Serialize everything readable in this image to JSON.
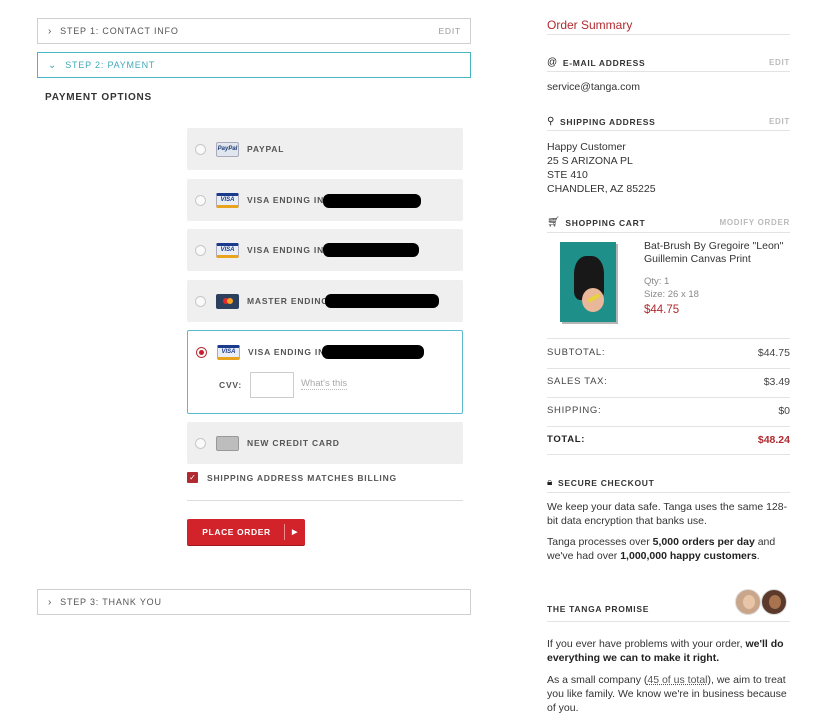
{
  "steps": {
    "step1": {
      "label": "STEP 1: CONTACT INFO",
      "edit": "EDIT"
    },
    "step2": {
      "label": "STEP 2: PAYMENT"
    },
    "step3": {
      "label": "STEP 3: THANK YOU"
    }
  },
  "payment": {
    "title": "PAYMENT OPTIONS",
    "options": [
      {
        "label": "PAYPAL",
        "icon": "paypal-icon",
        "selected": false
      },
      {
        "label": "VISA ENDING IN",
        "icon": "visa-card-icon",
        "selected": false
      },
      {
        "label": "VISA ENDING IN",
        "icon": "visa-card-icon",
        "selected": false
      },
      {
        "label": "MASTER ENDING",
        "icon": "mastercard-icon",
        "selected": false
      },
      {
        "label": "VISA ENDING IN",
        "icon": "visa-card-icon",
        "selected": true
      },
      {
        "label": "NEW CREDIT CARD",
        "icon": "credit-card-icon",
        "selected": false
      }
    ],
    "cvv_label": "CVV:",
    "cvv_value": "",
    "whats_this": "What's this",
    "billing_match_label": "SHIPPING ADDRESS MATCHES BILLING",
    "billing_match_checked": true,
    "place_order_label": "PLACE ORDER",
    "paypal_icon_text": "PayPal",
    "visa_icon_text": "VISA"
  },
  "summary": {
    "title": "Order Summary",
    "email": {
      "heading": "E-MAIL ADDRESS",
      "edit": "EDIT",
      "value": "service@tanga.com"
    },
    "shipping": {
      "heading": "SHIPPING ADDRESS",
      "edit": "EDIT",
      "lines": [
        "Happy Customer",
        "25 S ARIZONA PL",
        "STE 410",
        "CHANDLER, AZ 85225"
      ]
    },
    "cart": {
      "heading": "SHOPPING CART",
      "modify": "MODIFY ORDER",
      "item": {
        "name": "Bat-Brush By Gregoire \"Leon\" Guillemin Canvas Print",
        "qty": "Qty: 1",
        "size": "Size: 26 x 18",
        "price": "$44.75"
      }
    },
    "totals": [
      {
        "label": "SUBTOTAL:",
        "value": "$44.75"
      },
      {
        "label": "SALES TAX:",
        "value": "$3.49"
      },
      {
        "label": "SHIPPING:",
        "value": "$0"
      },
      {
        "label": "TOTAL:",
        "value": "$48.24"
      }
    ],
    "secure": {
      "heading": "SECURE CHECKOUT",
      "p1": "We keep your data safe. Tanga uses the same 128-bit data encryption that banks use.",
      "p2_a": "Tanga processes over ",
      "p2_b": "5,000 orders per day",
      "p2_c": " and we've had over ",
      "p2_d": "1,000,000 happy customers",
      "p2_e": "."
    },
    "promise": {
      "heading": "THE TANGA PROMISE",
      "p1_a": "If you ever have problems with your order, ",
      "p1_b": "we'll do everything we can to make it right.",
      "p2_a": "As a small company (",
      "p2_b": "45 of us total",
      "p2_c": "), we aim to treat you like family. We know we're in business because of you."
    }
  }
}
